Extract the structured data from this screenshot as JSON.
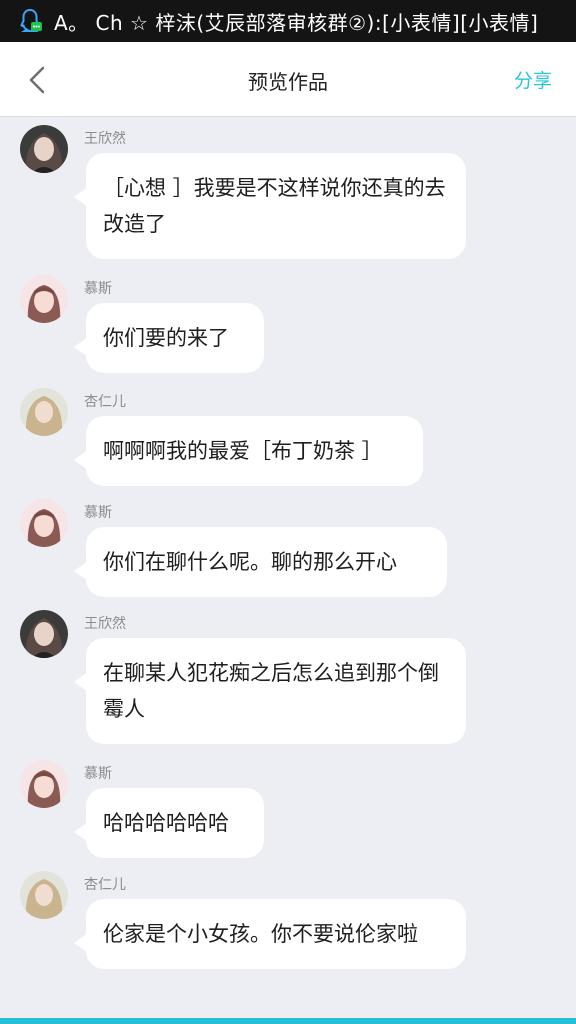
{
  "status_bar": {
    "notification_text": "A。 Ch ☆ 梓沫(艾辰部落审核群②):[小表情][小表情]",
    "icon": "qq-penguin-icon"
  },
  "header": {
    "back_icon": "chevron-left-icon",
    "title": "预览作品",
    "share_label": "分享"
  },
  "messages": [
    {
      "sender": "王欣然",
      "text": "［心想 ］我要是不这样说你还真的去改造了",
      "avatar": "avatar-dark-hair"
    },
    {
      "sender": "慕斯",
      "text": "你们要的来了",
      "avatar": "avatar-pink-girl"
    },
    {
      "sender": "杏仁儿",
      "text": "啊啊啊我的最爱［布丁奶茶 ］",
      "avatar": "avatar-blonde-girl"
    },
    {
      "sender": "慕斯",
      "text": "你们在聊什么呢。聊的那么开心",
      "avatar": "avatar-pink-girl"
    },
    {
      "sender": "王欣然",
      "text": "在聊某人犯花痴之后怎么追到那个倒霉人",
      "avatar": "avatar-dark-hair"
    },
    {
      "sender": "慕斯",
      "text": "哈哈哈哈哈哈",
      "avatar": "avatar-pink-girl"
    },
    {
      "sender": "杏仁儿",
      "text": "伦家是个小女孩。你不要说伦家啦",
      "avatar": "avatar-blonde-girl"
    }
  ],
  "colors": {
    "accent": "#2cc5d8",
    "background": "#eceef3",
    "status_bar": "#141414"
  }
}
